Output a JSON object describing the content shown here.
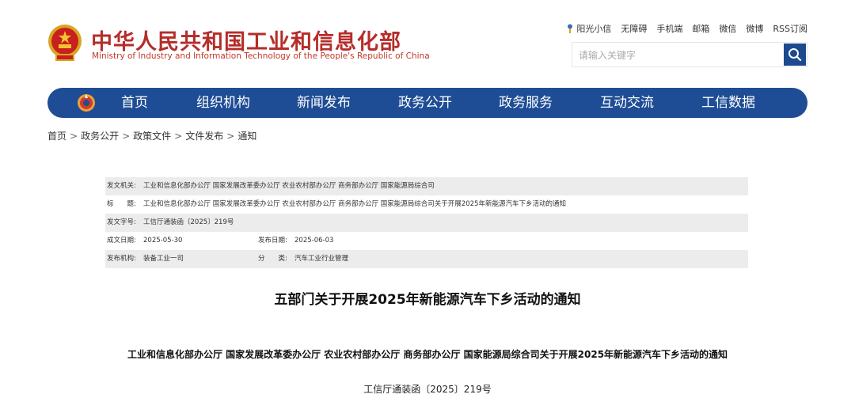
{
  "header": {
    "title_cn": "中华人民共和国工业和信息化部",
    "title_en": "Ministry of Industry and Information Technology of the People's Republic of China",
    "emblem_icon": "national-emblem-icon",
    "top_links": [
      "阳光小信",
      "无障碍",
      "手机端",
      "邮箱",
      "微信",
      "微博",
      "RSS订阅"
    ],
    "search_placeholder": "请输入关键字",
    "brand_color": "#b52d2a"
  },
  "nav": {
    "color": "#1e4d95",
    "logo_icon": "miit-logo-icon",
    "items": [
      "首页",
      "组织机构",
      "新闻发布",
      "政务公开",
      "政务服务",
      "互动交流",
      "工信数据"
    ]
  },
  "breadcrumb": [
    "首页",
    "政务公开",
    "政策文件",
    "文件发布",
    "通知"
  ],
  "meta": {
    "issuer_label": "发文机关:",
    "issuer": "工业和信息化部办公厅 国家发展改革委办公厅 农业农村部办公厅 商务部办公厅 国家能源局综合司",
    "title_label": "标　　题:",
    "title": "工业和信息化部办公厅 国家发展改革委办公厅 农业农村部办公厅 商务部办公厅 国家能源局综合司关于开展2025年新能源汽车下乡活动的通知",
    "docno_label": "发文字号:",
    "docno": "工信厅通装函〔2025〕219号",
    "written_label": "成文日期:",
    "written": "2025-05-30",
    "published_label": "发布日期:",
    "published": "2025-06-03",
    "org_label": "发布机构:",
    "org": "装备工业一司",
    "category_label": "分　　类:",
    "category": "汽车工业行业管理"
  },
  "article": {
    "title": "五部门关于开展2025年新能源汽车下乡活动的通知",
    "issuer_line": "工业和信息化部办公厅 国家发展改革委办公厅 农业农村部办公厅 商务部办公厅 国家能源局综合司关于开展2025年新能源汽车下乡活动的通知",
    "doc_number": "工信厅通装函〔2025〕219号"
  }
}
